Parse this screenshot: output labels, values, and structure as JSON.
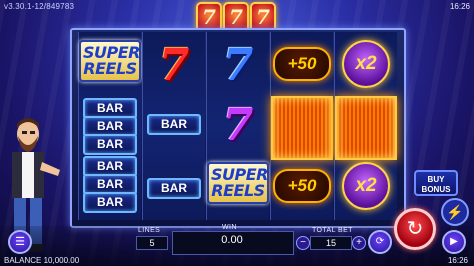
{
  "header": {
    "version": "v3.30.1-12/849783",
    "clock_top": "16:26"
  },
  "logo": {
    "symbols": [
      "7",
      "7",
      "7"
    ]
  },
  "reels": [
    {
      "symbols": [
        "SUPER REELS",
        "BAR",
        "BAR",
        "BAR",
        "BAR",
        "BAR",
        "BAR"
      ]
    },
    {
      "symbols": [
        "7",
        "BAR",
        "BAR"
      ]
    },
    {
      "symbols": [
        "7",
        "7",
        "SUPER REELS"
      ]
    },
    {
      "symbols": [
        "+50",
        "",
        "+50"
      ]
    },
    {
      "symbols": [
        "x2",
        "",
        "x2"
      ]
    }
  ],
  "symbol_text": {
    "super_reels_line1": "SUPER",
    "super_reels_line2": "REELS",
    "bar": "BAR",
    "seven": "7",
    "plus50": "+50",
    "x2": "x2"
  },
  "buttons": {
    "buy_bonus_line1": "BUY",
    "buy_bonus_line2": "BONUS",
    "bolt_icon": "⚡",
    "menu_icon": "☰",
    "stepper_minus": "−",
    "stepper_plus": "+",
    "autoplay_icon": "⟳",
    "spin_icon": "↻",
    "turbo_icon": "▶"
  },
  "bottom": {
    "lines_label": "LINES",
    "lines_value": "5",
    "win_label": "WIN",
    "win_value": "0.00",
    "total_bet_label": "TOTAL BET",
    "total_bet_value": "15",
    "balance": "BALANCE 10,000.00",
    "clock": "16:26"
  },
  "colors": {
    "spin": "#d4121c",
    "accent": "#ffb000",
    "frame": "#8fa5ff"
  }
}
